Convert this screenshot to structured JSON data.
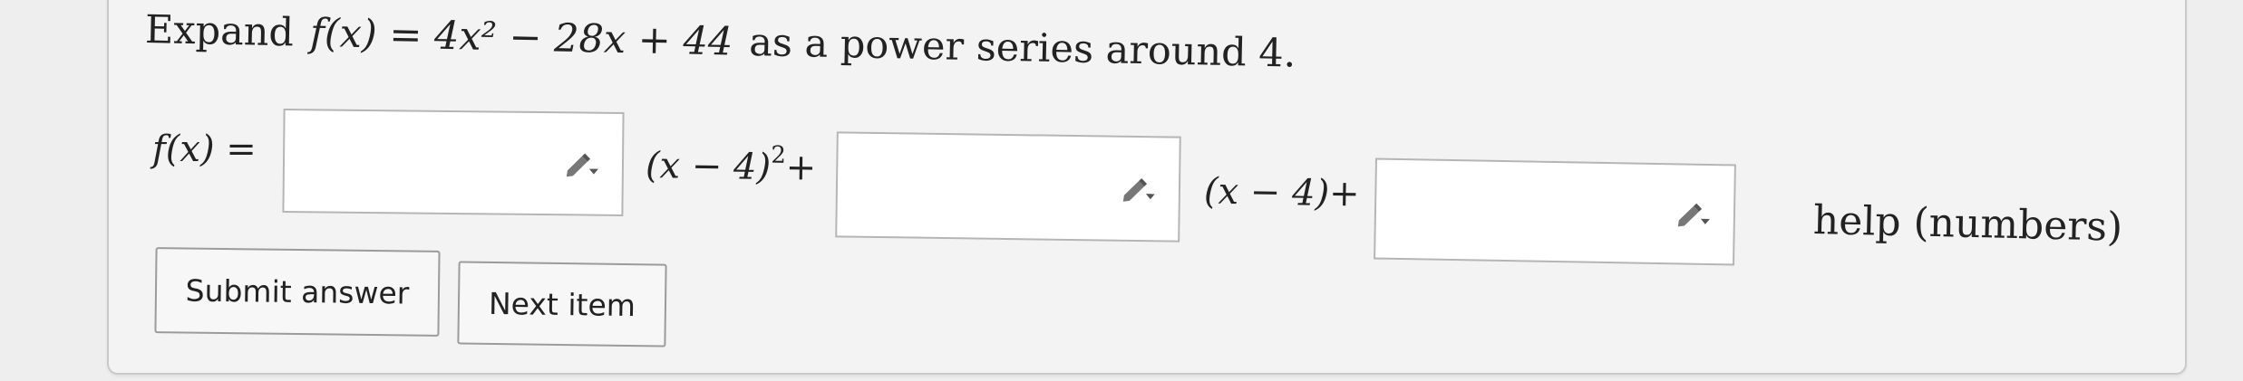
{
  "question": {
    "prefix": "Expand",
    "function": "f(x) = 4x² − 28x + 44",
    "suffix": "as a power series around 4."
  },
  "answer": {
    "lhs": "f(x) =",
    "boxes": [
      {
        "value": "",
        "term": "(x − 4)",
        "exponent": "2",
        "plus": "+"
      },
      {
        "value": "",
        "term": "(x − 4)",
        "exponent": "",
        "plus": "+"
      },
      {
        "value": ""
      }
    ],
    "help": "help (numbers)",
    "editor_icon": "pencil-dropdown-icon"
  },
  "buttons": {
    "submit": "Submit answer",
    "next": "Next item"
  }
}
